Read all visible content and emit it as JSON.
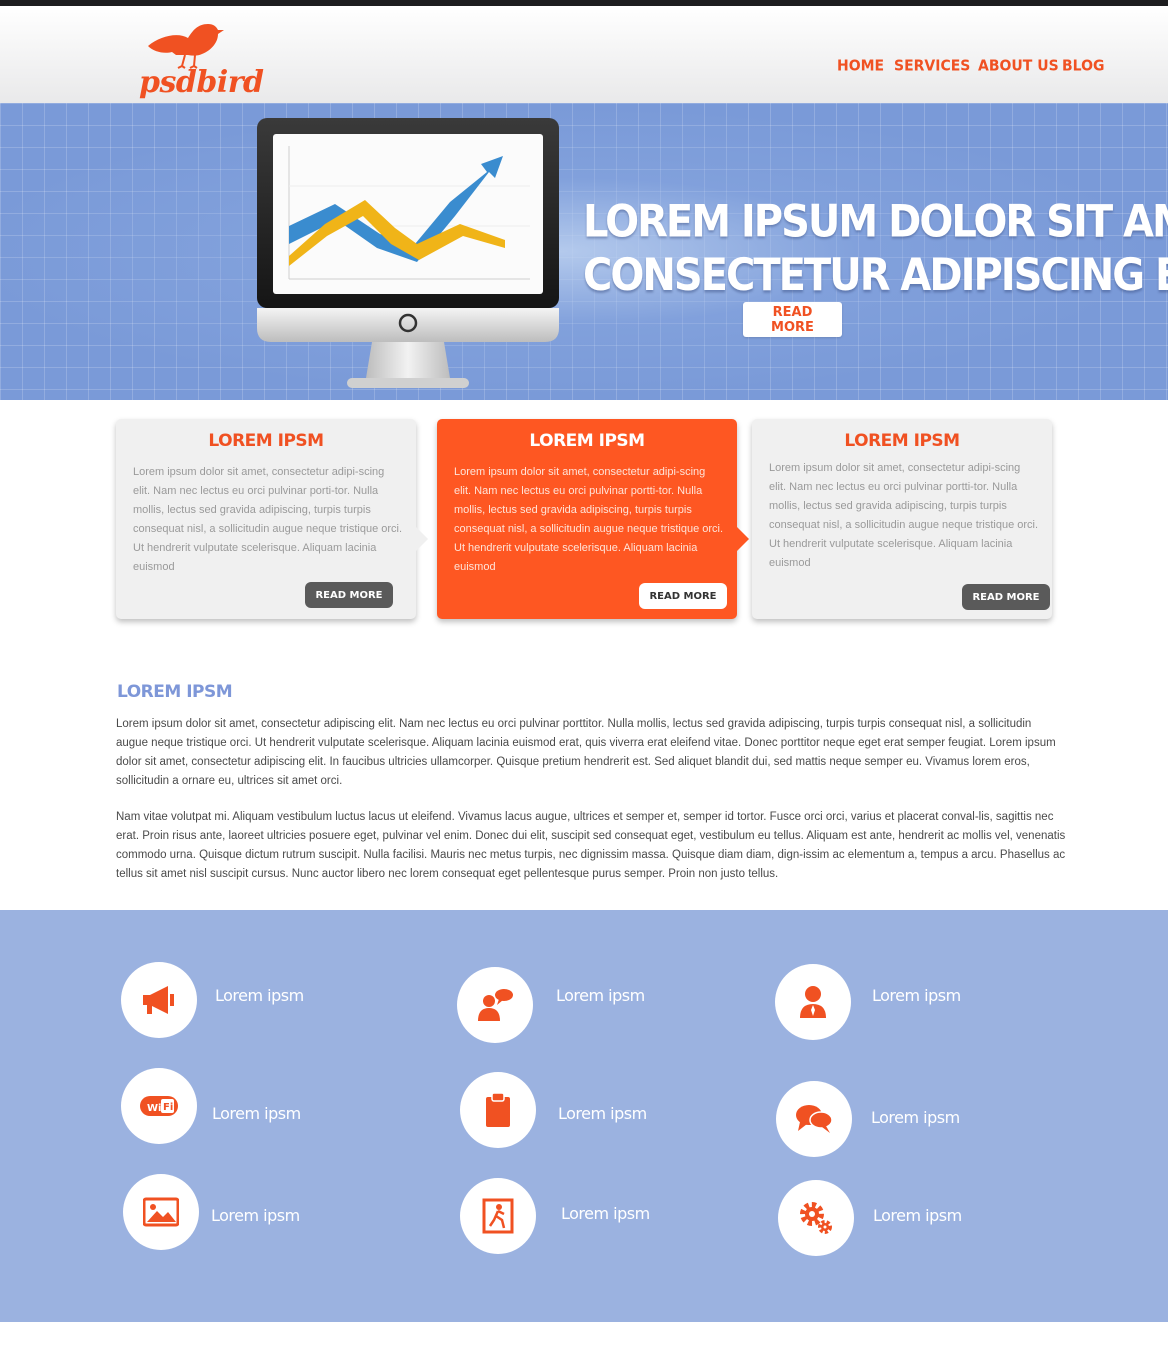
{
  "brand": {
    "name": "psdbird",
    "accent": "#f05122",
    "blue": "#7e97d8"
  },
  "nav": [
    {
      "label": "HOME"
    },
    {
      "label": "SERVICES"
    },
    {
      "label": "ABOUT US"
    },
    {
      "label": "BLOG"
    }
  ],
  "hero": {
    "title_line1": "LOREM IPSUM DOLOR SIT AME",
    "title_line2": "CONSECTETUR ADIPISCING EL",
    "button": "READ MORE"
  },
  "cards": [
    {
      "title": "LOREM IPSM",
      "text": "Lorem ipsum dolor sit amet, consectetur adipi-scing elit. Nam nec lectus eu orci pulvinar porti-tor. Nulla mollis, lectus sed gravida adipiscing, turpis turpis consequat nisl, a sollicitudin augue neque tristique orci. Ut hendrerit vulputate scelerisque. Aliquam lacinia euismod",
      "button": "READ MORE"
    },
    {
      "title": "LOREM IPSM",
      "text": "Lorem ipsum dolor sit amet, consectetur adipi-scing elit. Nam nec lectus eu orci pulvinar portti-tor. Nulla mollis, lectus sed gravida adipiscing, turpis turpis consequat nisl, a sollicitudin augue neque tristique orci. Ut hendrerit vulputate scelerisque. Aliquam lacinia euismod",
      "button": "READ MORE"
    },
    {
      "title": "LOREM IPSM",
      "text": "Lorem ipsum dolor sit amet, consectetur adipi-scing elit. Nam nec lectus eu orci pulvinar portti-tor. Nulla mollis, lectus sed gravida adipiscing, turpis turpis consequat nisl, a sollicitudin augue neque tristique orci. Ut hendrerit vulputate scelerisque. Aliquam lacinia euismod",
      "button": "READ MORE"
    }
  ],
  "about": {
    "title": "LOREM IPSM",
    "para1": "Lorem ipsum dolor sit amet, consectetur adipiscing elit. Nam nec lectus eu orci pulvinar porttitor. Nulla mollis, lectus sed gravida adipiscing, turpis turpis consequat nisl, a sollicitudin augue neque tristique orci. Ut hendrerit vulputate scelerisque. Aliquam lacinia euismod erat, quis viverra erat eleifend vitae. Donec porttitor neque eget erat semper feugiat. Lorem ipsum dolor sit amet, consectetur adipiscing elit. In faucibus ultricies ullamcorper. Quisque pretium hendrerit est. Sed aliquet blandit dui, sed mattis neque semper eu. Vivamus lorem eros, sollicitudin a ornare eu, ultrices sit amet orci.",
    "para2": "Nam vitae volutpat mi. Aliquam vestibulum luctus lacus ut eleifend. Vivamus lacus augue, ultrices et semper et, semper id tortor. Fusce orci orci, varius et placerat conval-lis, sagittis nec erat. Proin risus ante, laoreet ultricies posuere eget, pulvinar vel enim. Donec dui elit, suscipit sed consequat eget, vestibulum eu tellus. Aliquam est ante, hendrerit ac mollis vel, venenatis commodo urna. Quisque dictum rutrum suscipit. Nulla facilisi. Mauris nec metus turpis, nec dignissim massa. Quisque diam diam, dign-issim ac elementum a, tempus a arcu. Phasellus ac tellus sit amet nisl suscipit cursus. Nunc auctor libero nec lorem consequat eget pellentesque purus semper. Proin non justo tellus."
  },
  "features": [
    {
      "icon": "megaphone-icon",
      "label": "Lorem ipsm"
    },
    {
      "icon": "person-chat-icon",
      "label": "Lorem ipsm"
    },
    {
      "icon": "user-icon",
      "label": "Lorem ipsm"
    },
    {
      "icon": "wifi-icon",
      "label": "Lorem ipsm"
    },
    {
      "icon": "clipboard-icon",
      "label": "Lorem ipsm"
    },
    {
      "icon": "chat-bubbles-icon",
      "label": "Lorem ipsm"
    },
    {
      "icon": "image-icon",
      "label": "Lorem ipsm"
    },
    {
      "icon": "exit-icon",
      "label": "Lorem ipsm"
    },
    {
      "icon": "gear-icon",
      "label": "Lorem ipsm"
    }
  ],
  "colors": {
    "features_bg": "#9bb2e0",
    "card_active": "#fe5722",
    "card_bg": "#f0f0f0"
  }
}
